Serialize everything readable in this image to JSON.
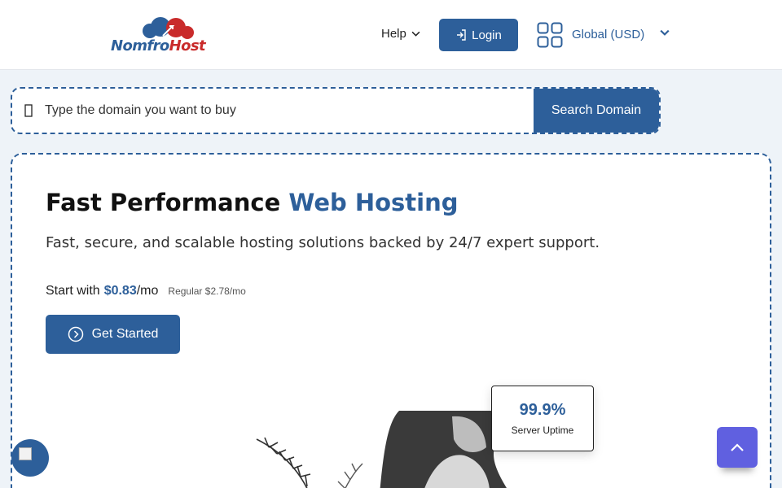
{
  "header": {
    "logo": {
      "part1": "Nomfro",
      "part2": "Host"
    },
    "help_label": "Help",
    "login_label": "Login",
    "currency_label": "Global (USD)"
  },
  "search": {
    "placeholder": "Type the domain you want to buy",
    "button_label": "Search Domain"
  },
  "hero": {
    "title_main": "Fast Performance",
    "title_accent": "Web Hosting",
    "subtitle": "Fast, secure, and scalable hosting solutions backed by 24/7 expert support.",
    "price_prefix": "Start with",
    "price_amount": "$0.83",
    "price_suffix": "/mo",
    "regular_price": "Regular $2.78/mo",
    "cta_label": "Get Started"
  },
  "uptime": {
    "value": "99.9%",
    "label": "Server Uptime"
  },
  "colors": {
    "brand": "#2d5f9a",
    "logo_red": "#c92b2b",
    "scroll_button": "#6060e0"
  },
  "icons": [
    "chevron-down-icon",
    "login-icon",
    "grid-icon",
    "search-icon",
    "arrow-circle-right-icon",
    "chevron-up-icon"
  ]
}
